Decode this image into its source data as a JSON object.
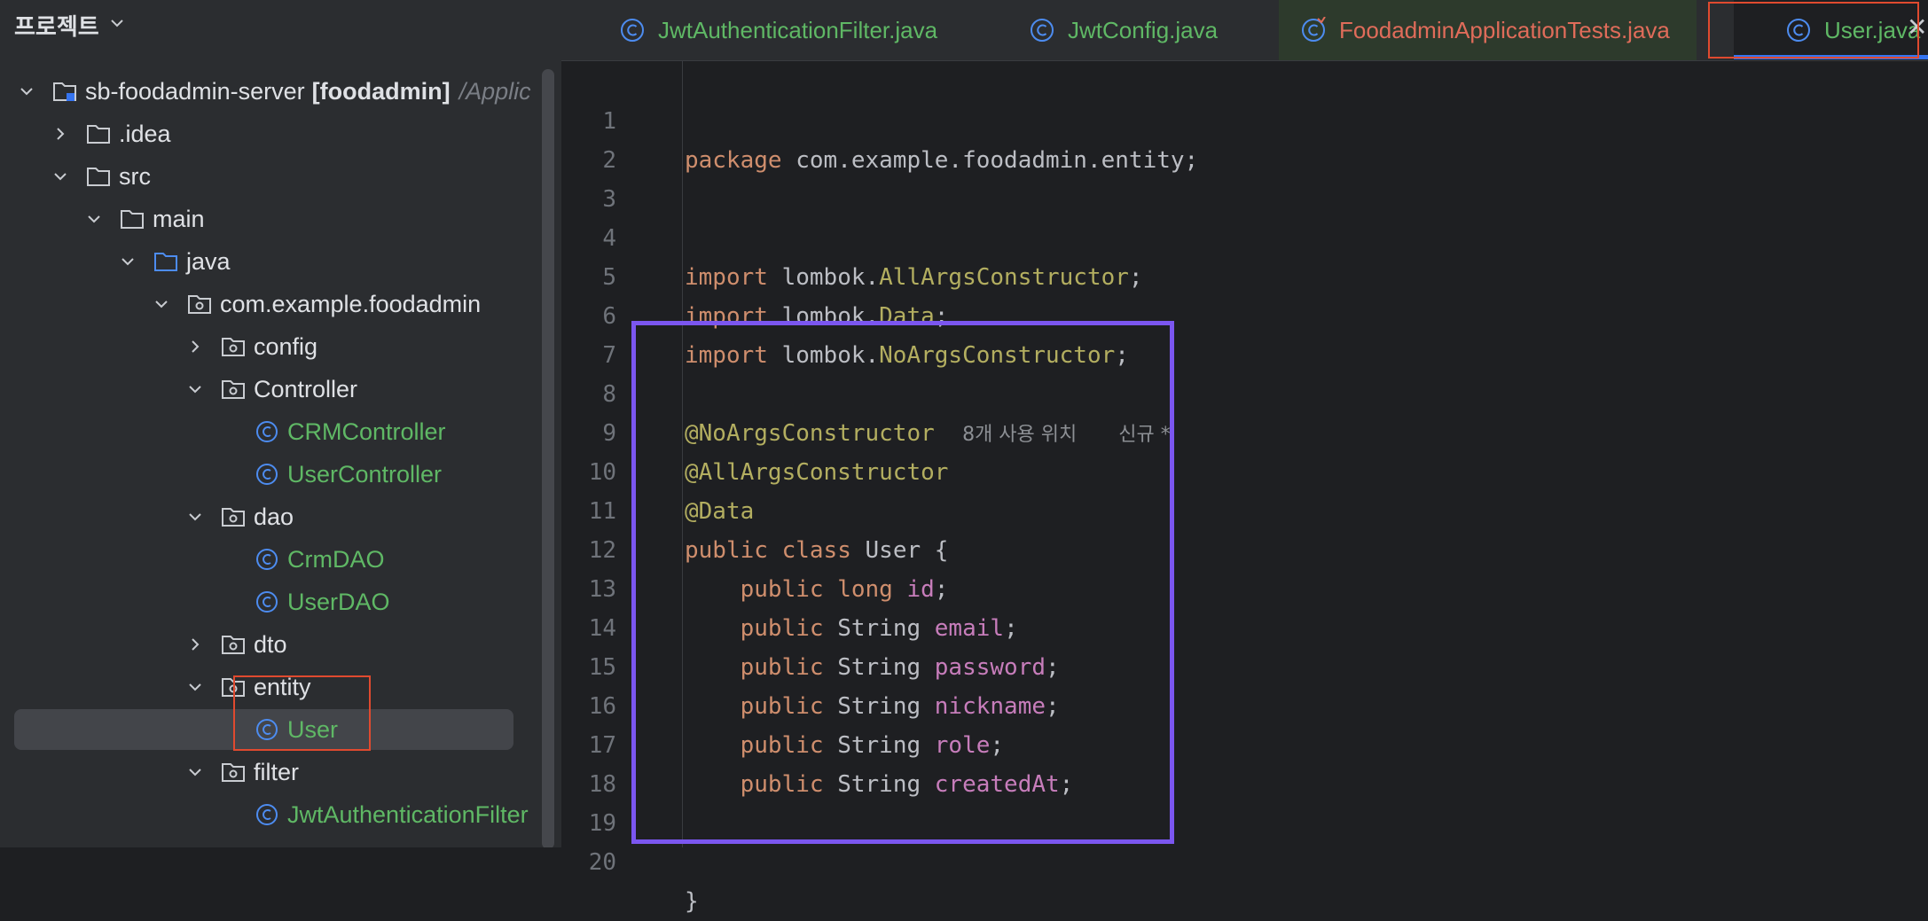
{
  "project_panel": {
    "title": "프로젝트",
    "tree": {
      "root": {
        "name": "sb-foodadmin-server",
        "module": "[foodadmin]",
        "path": "/Applic"
      },
      "idea": ".idea",
      "src": "src",
      "main": "main",
      "java": "java",
      "package": "com.example.foodadmin",
      "config": "config",
      "controller": "Controller",
      "crm_controller": "CRMController",
      "user_controller": "UserController",
      "dao": "dao",
      "crm_dao": "CrmDAO",
      "user_dao": "UserDAO",
      "dto": "dto",
      "entity": "entity",
      "user": "User",
      "filter": "filter",
      "jwt_filter": "JwtAuthenticationFilter"
    }
  },
  "tabs": [
    {
      "label": "JwtAuthenticationFilter.java"
    },
    {
      "label": "JwtConfig.java"
    },
    {
      "label": "FoodadminApplicationTests.java"
    },
    {
      "label": "User.java",
      "active": true
    }
  ],
  "editor": {
    "line_numbers": [
      "1",
      "2",
      "3",
      "4",
      "5",
      "6",
      "7",
      "8",
      "9",
      "10",
      "11",
      "12",
      "13",
      "14",
      "15",
      "16",
      "17",
      "18",
      "19",
      "20"
    ],
    "tokens": {
      "package_kw": "package",
      "package_name": "com.example.foodadmin.entity;",
      "import_kw": "import",
      "lombok_prefix": "lombok.",
      "all_args_ctor": "AllArgsConstructor",
      "data_cls": "Data",
      "no_args_ctor": "NoArgsConstructor",
      "semicolon": ";",
      "ann_no_args": "@NoArgsConstructor",
      "usage_hint": "8개 사용 위치",
      "new_hint": "신규 *",
      "ann_all_args": "@AllArgsConstructor",
      "ann_data": "@Data",
      "public_kw": "public",
      "class_kw": "class",
      "class_name": "User {",
      "long_kw": "long",
      "string_type": "String",
      "field_id": "id",
      "field_email": "email",
      "field_password": "password",
      "field_nickname": "nickname",
      "field_role": "role",
      "field_created_at": "createdAt",
      "close_brace": "}"
    }
  },
  "colors": {
    "accent_blue": "#3574f0",
    "highlight_purple": "#7b56f0",
    "highlight_red": "#e04a2f",
    "class_green": "#5fb865"
  }
}
